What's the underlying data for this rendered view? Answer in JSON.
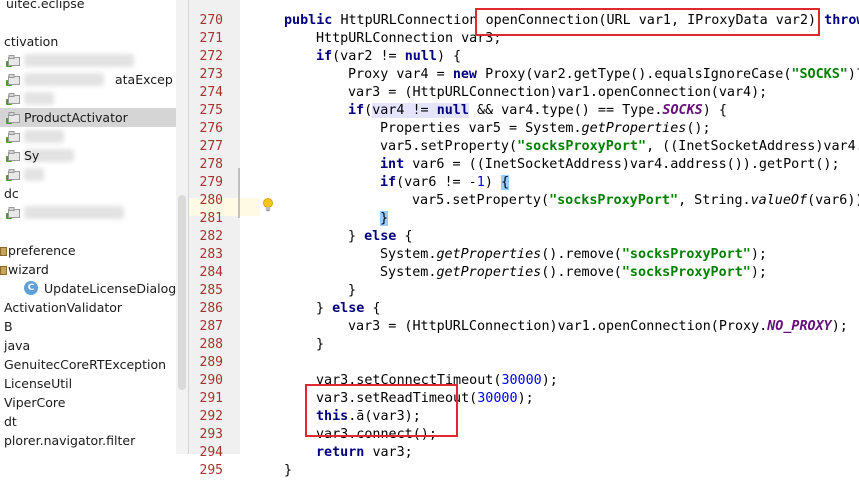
{
  "colors": {
    "red_box": "#e0282f",
    "line_number": "#a83232",
    "keyword": "#000080",
    "string": "#008000",
    "number": "#0000ff"
  },
  "tree": {
    "rows": [
      {
        "label": "uitec.eclipse",
        "indent": 6,
        "icon": "none"
      },
      {
        "label": "",
        "indent": 6,
        "icon": "none"
      },
      {
        "label": "ctivation",
        "indent": 0,
        "icon": "none"
      },
      {
        "label": "",
        "indent": 6,
        "icon": "package-icon",
        "blur": 110
      },
      {
        "label": "ataExcep",
        "indent": 6,
        "icon": "package-icon",
        "blur": 80,
        "label_left": 115
      },
      {
        "label": "",
        "indent": 6,
        "icon": "package-icon",
        "blur": 30
      },
      {
        "label": "ProductActivator",
        "indent": 6,
        "icon": "package-icon",
        "selected": true
      },
      {
        "label": "",
        "indent": 6,
        "icon": "package-icon",
        "blur": 40
      },
      {
        "label": "Sy",
        "indent": 6,
        "icon": "package-icon",
        "blur": 50
      },
      {
        "label": "",
        "indent": 6,
        "icon": "package-icon",
        "blur": 20
      },
      {
        "label": "dc",
        "indent": 0,
        "icon": "none"
      },
      {
        "label": "",
        "indent": 6,
        "icon": "package-icon",
        "blur": 100
      },
      {
        "label": "",
        "indent": 0,
        "icon": "none"
      },
      {
        "label": "preference",
        "indent": 0,
        "icon": "folder-icon"
      },
      {
        "label": "wizard",
        "indent": 0,
        "icon": "folder-icon"
      },
      {
        "label": "UpdateLicenseDialog",
        "indent": 24,
        "icon": "class-icon"
      },
      {
        "label": "ActivationValidator",
        "indent": 0,
        "icon": "none"
      },
      {
        "label": "B",
        "indent": 0,
        "icon": "none"
      },
      {
        "label": "java",
        "indent": 0,
        "icon": "none"
      },
      {
        "label": "GenuitecCoreRTException",
        "indent": 0,
        "icon": "none"
      },
      {
        "label": "LicenseUtil",
        "indent": 0,
        "icon": "none"
      },
      {
        "label": "ViperCore",
        "indent": 0,
        "icon": "none"
      },
      {
        "label": "dt",
        "indent": 0,
        "icon": "none"
      },
      {
        "label": "plorer.navigator.filter",
        "indent": 0,
        "icon": "none"
      },
      {
        "label": "",
        "indent": 0,
        "icon": "none"
      }
    ]
  },
  "editor": {
    "lines": [
      {
        "n": "270",
        "indent": 24,
        "tokens": [
          [
            "kw",
            "public "
          ],
          [
            "",
            "HttpURLConnection "
          ],
          [
            "",
            "openConnection(URL var1, IProxyData var2) "
          ],
          [
            "kw",
            "throws"
          ]
        ]
      },
      {
        "n": "271",
        "indent": 56,
        "tokens": [
          [
            "",
            "HttpURLConnection var3;"
          ]
        ]
      },
      {
        "n": "272",
        "indent": 56,
        "tokens": [
          [
            "kw",
            "if"
          ],
          [
            "",
            "(var2 != "
          ],
          [
            "kw",
            "null"
          ],
          [
            "",
            ") {"
          ]
        ]
      },
      {
        "n": "273",
        "indent": 88,
        "tokens": [
          [
            "",
            "Proxy var4 = "
          ],
          [
            "kw",
            "new "
          ],
          [
            "",
            "Proxy(var2.getType().equalsIgnoreCase("
          ],
          [
            "str",
            "\"SOCKS\""
          ],
          [
            "",
            ")?"
          ]
        ]
      },
      {
        "n": "274",
        "indent": 88,
        "tokens": [
          [
            "",
            "var3 = (HttpURLConnection)var1.openConnection(var4);"
          ]
        ]
      },
      {
        "n": "275",
        "indent": 88,
        "tokens": [
          [
            "kw",
            "if"
          ],
          [
            "",
            "("
          ],
          [
            "mark",
            "var4 != "
          ],
          [
            "kw mark",
            "null"
          ],
          [
            "",
            " && var4.type() == Type."
          ],
          [
            "fld",
            "SOCKS"
          ],
          [
            "",
            ") {"
          ]
        ]
      },
      {
        "n": "276",
        "indent": 120,
        "tokens": [
          [
            "",
            "Properties var5 = System."
          ],
          [
            "it",
            "getProperties"
          ],
          [
            "",
            "();"
          ]
        ]
      },
      {
        "n": "277",
        "indent": 120,
        "tokens": [
          [
            "",
            "var5.setProperty("
          ],
          [
            "str",
            "\"socksProxyPort\""
          ],
          [
            "",
            ", ((InetSocketAddress)var4."
          ]
        ]
      },
      {
        "n": "278",
        "indent": 120,
        "tokens": [
          [
            "kw",
            "int "
          ],
          [
            "",
            "var6 = ((InetSocketAddress)var4.address()).getPort();"
          ]
        ]
      },
      {
        "n": "279",
        "indent": 120,
        "tokens": [
          [
            "kw",
            "if"
          ],
          [
            "",
            "(var6 != -"
          ],
          [
            "num",
            "1"
          ],
          [
            "",
            ") "
          ],
          [
            "brace",
            "{"
          ]
        ]
      },
      {
        "n": "280",
        "indent": 152,
        "tokens": [
          [
            "",
            "var5.setProperty("
          ],
          [
            "str",
            "\"socksProxyPort\""
          ],
          [
            "",
            ", String."
          ],
          [
            "it",
            "valueOf"
          ],
          [
            "",
            "(var6));"
          ]
        ]
      },
      {
        "n": "281",
        "indent": 120,
        "tokens": [
          [
            "brace",
            "}"
          ]
        ]
      },
      {
        "n": "282",
        "indent": 88,
        "tokens": [
          [
            "",
            "} "
          ],
          [
            "kw",
            "else "
          ],
          [
            "",
            "{"
          ]
        ]
      },
      {
        "n": "283",
        "indent": 120,
        "tokens": [
          [
            "",
            "System."
          ],
          [
            "it",
            "getProperties"
          ],
          [
            "",
            "().remove("
          ],
          [
            "str",
            "\"socksProxyPort\""
          ],
          [
            "",
            ");"
          ]
        ]
      },
      {
        "n": "284",
        "indent": 120,
        "tokens": [
          [
            "",
            "System."
          ],
          [
            "it",
            "getProperties"
          ],
          [
            "",
            "().remove("
          ],
          [
            "str",
            "\"socksProxyPort\""
          ],
          [
            "",
            ");"
          ]
        ]
      },
      {
        "n": "285",
        "indent": 88,
        "tokens": [
          [
            "",
            "}"
          ]
        ]
      },
      {
        "n": "286",
        "indent": 56,
        "tokens": [
          [
            "",
            "} "
          ],
          [
            "kw",
            "else "
          ],
          [
            "",
            "{"
          ]
        ]
      },
      {
        "n": "287",
        "indent": 88,
        "tokens": [
          [
            "",
            "var3 = (HttpURLConnection)var1.openConnection(Proxy."
          ],
          [
            "fld",
            "NO_PROXY"
          ],
          [
            "",
            ");"
          ]
        ]
      },
      {
        "n": "288",
        "indent": 56,
        "tokens": [
          [
            "",
            "}"
          ]
        ]
      },
      {
        "n": "289",
        "indent": 56,
        "tokens": [
          [
            "",
            ""
          ]
        ]
      },
      {
        "n": "290",
        "indent": 56,
        "tokens": [
          [
            "",
            "var3.setConnectTimeout("
          ],
          [
            "num",
            "30000"
          ],
          [
            "",
            ");"
          ]
        ]
      },
      {
        "n": "291",
        "indent": 56,
        "tokens": [
          [
            "",
            "var3.setReadTimeout("
          ],
          [
            "num",
            "30000"
          ],
          [
            "",
            ");"
          ]
        ]
      },
      {
        "n": "292",
        "indent": 56,
        "tokens": [
          [
            "kw",
            "this"
          ],
          [
            "",
            ".ā(var3);"
          ]
        ]
      },
      {
        "n": "293",
        "indent": 56,
        "tokens": [
          [
            "",
            "var3.connect();"
          ]
        ]
      },
      {
        "n": "294",
        "indent": 56,
        "tokens": [
          [
            "kw",
            "return "
          ],
          [
            "",
            "var3;"
          ]
        ]
      },
      {
        "n": "295",
        "indent": 24,
        "tokens": [
          [
            "",
            "}"
          ]
        ]
      }
    ]
  }
}
